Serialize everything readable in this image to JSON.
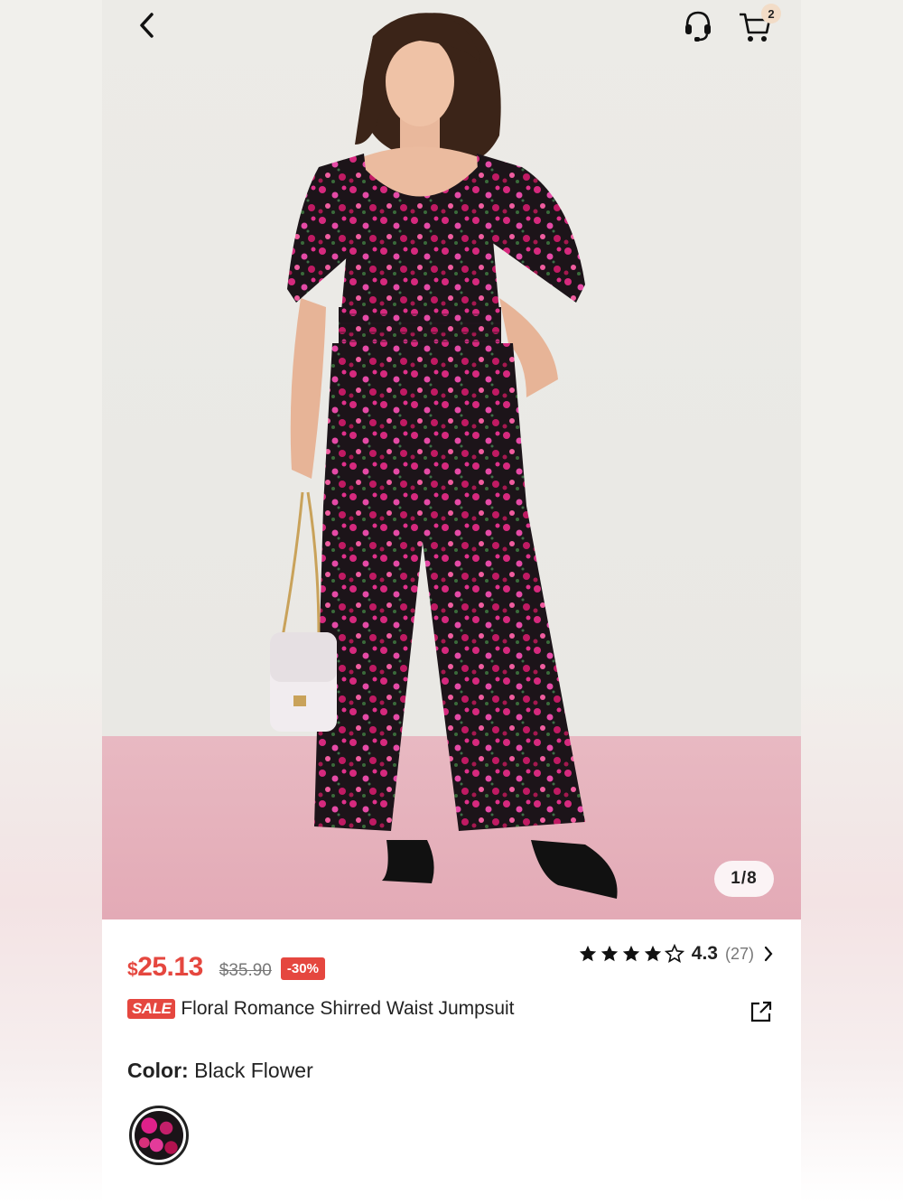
{
  "header": {
    "back_icon": "chevron-left-icon",
    "support_icon": "headset-icon",
    "cart_icon": "cart-icon",
    "cart_count": "2"
  },
  "gallery": {
    "pager": "1/8"
  },
  "product": {
    "price_currency": "$",
    "price_amount": "25.13",
    "original_price": "$35.90",
    "discount": "-30%",
    "rating": "4.3",
    "rating_stars": 4.3,
    "review_count": "(27)",
    "sale_tag": "SALE",
    "title": "Floral Romance Shirred Waist Jumpsuit",
    "color_label": "Color:",
    "color_value": "Black Flower"
  },
  "colors": {
    "accent": "#e5473f",
    "floor": "#e5b0bb",
    "badge": "#f2dcc7"
  }
}
